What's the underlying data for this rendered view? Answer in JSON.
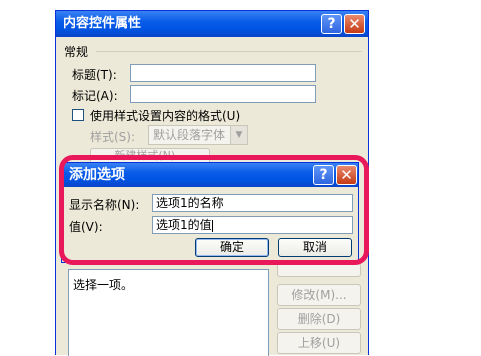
{
  "parent": {
    "title": "内容控件属性",
    "help_glyph": "?",
    "close_glyph": "✕",
    "section_general": "常规",
    "title_label": "标题(T):",
    "tag_label": "标记(A):",
    "use_style_label": "使用样式设置内容的格式(U)",
    "style_label": "样式(S):",
    "style_value": "默认段落字体",
    "new_style_label": "新建样式(N)...",
    "list_item": "选择一项。",
    "modify_button": "修改(M)...",
    "delete_button": "删除(D)",
    "move_up_button": "上移(U)"
  },
  "dialog": {
    "title": "添加选项",
    "help_glyph": "?",
    "close_glyph": "✕",
    "display_name_label": "显示名称(N):",
    "display_name_value": "选项1的名称",
    "value_label": "值(V):",
    "value_value": "选项1的值",
    "ok_button": "确定",
    "cancel_button": "取消"
  }
}
